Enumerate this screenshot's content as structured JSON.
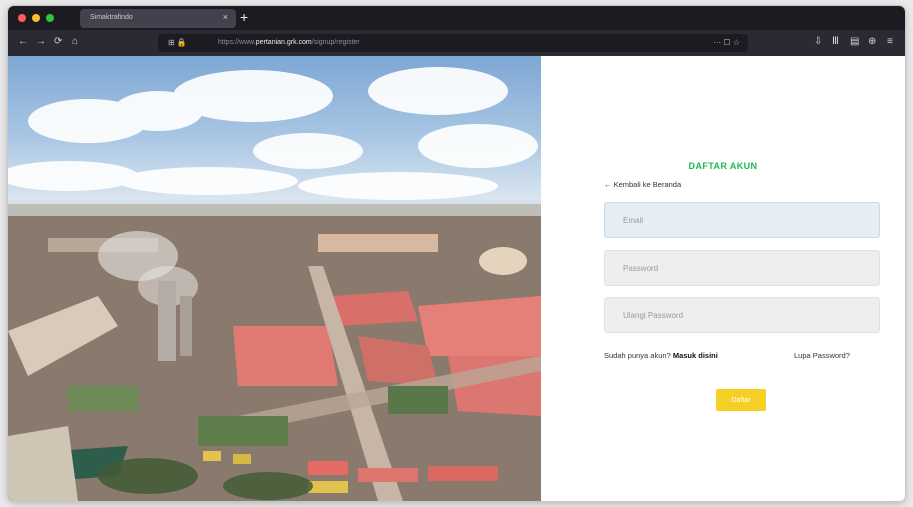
{
  "browser": {
    "tab_title": "Simaktrafindo",
    "tab_close": "×",
    "new_tab": "+",
    "url_prefix": "https://www.",
    "url_domain": "pertanian.grk.com",
    "url_path": "/signup/register",
    "url_left_icons": "⊞ 🔒",
    "url_right_icons": "··· ☐ ☆",
    "toolbar_icons": {
      "back": "←",
      "forward": "→",
      "reload": "⟳",
      "home": "⌂",
      "download": "⇩",
      "library": "Ⅲ",
      "sidebar": "▤",
      "extensions": "⊕",
      "menu": "≡"
    }
  },
  "hero": {
    "image_description": "aerial-industrial-plant-photo"
  },
  "form": {
    "title": "DAFTAR AKUN",
    "back_link": "← Kembali ke Beranda",
    "email_placeholder": "Email",
    "password_placeholder": "Password",
    "confirm_placeholder": "Ulangi Password",
    "login_prompt": "Sudah punya akun?",
    "login_link": "Masuk disini",
    "forgot_link": "Lupa Password?",
    "submit_label": "Daftar"
  },
  "colors": {
    "title_green": "#1db954",
    "submit_yellow": "#f4cf24",
    "browser_dark": "#1c1b22"
  }
}
